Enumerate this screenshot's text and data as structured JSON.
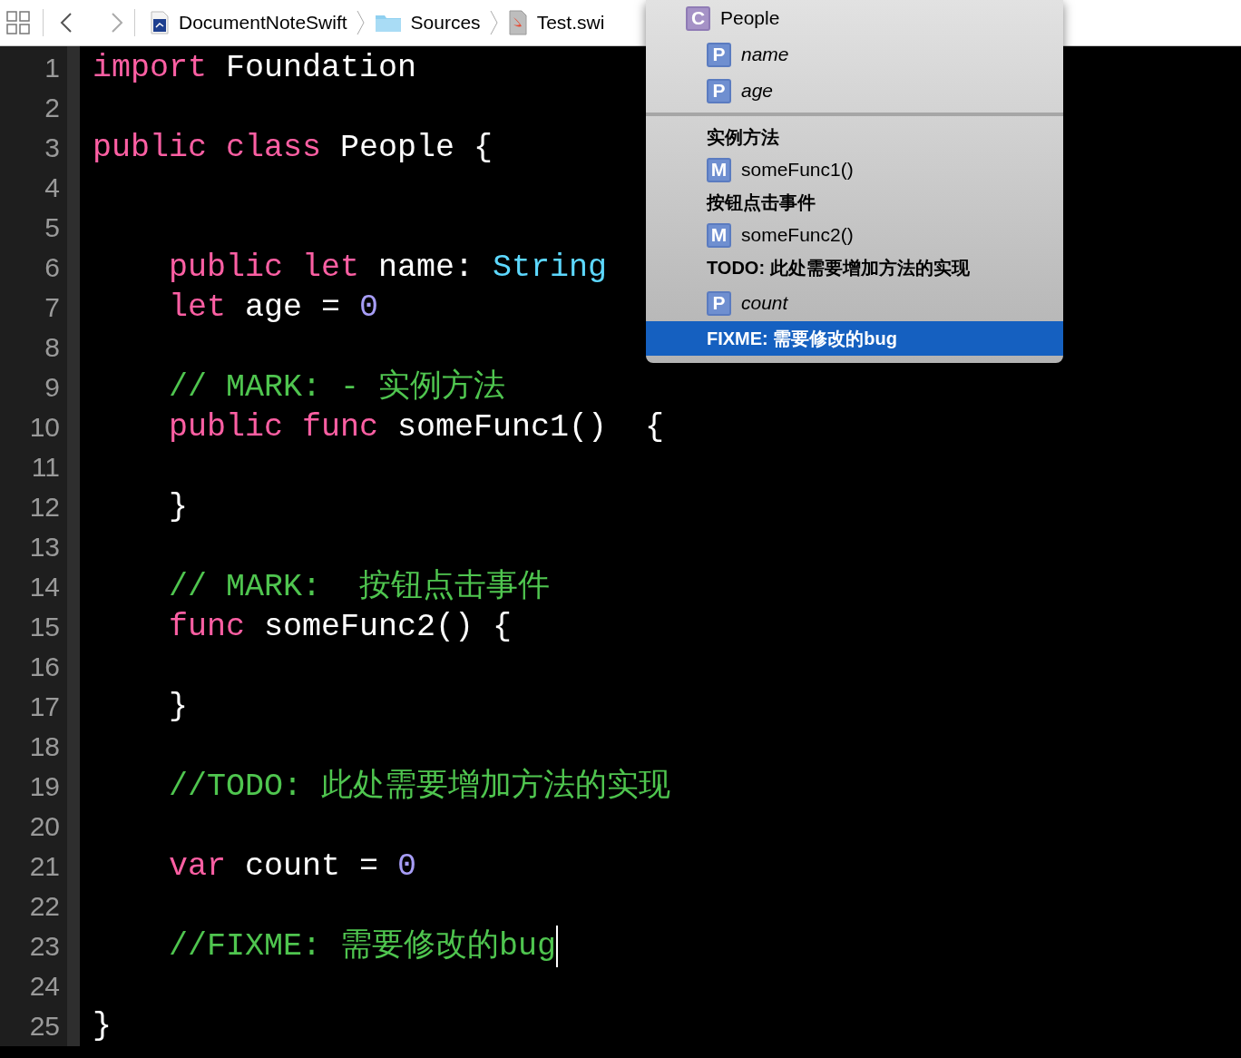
{
  "toolbar": {
    "breadcrumbs": [
      {
        "kind": "project",
        "label": "DocumentNoteSwift"
      },
      {
        "kind": "folder",
        "label": "Sources"
      },
      {
        "kind": "file",
        "label": "Test.swi"
      }
    ]
  },
  "editor": {
    "lines": [
      {
        "number": "1",
        "tokens": [
          {
            "kind": "keyword",
            "text": "import"
          },
          {
            "kind": "plain",
            "text": " Foundation"
          }
        ]
      },
      {
        "number": "2"
      },
      {
        "number": "3",
        "tokens": [
          {
            "kind": "keyword",
            "text": "public class"
          },
          {
            "kind": "plain",
            "text": " People {"
          }
        ]
      },
      {
        "number": "4"
      },
      {
        "number": "5"
      },
      {
        "number": "6",
        "tokens": [
          {
            "kind": "keyword",
            "text": "    public let"
          },
          {
            "kind": "plain",
            "text": " name: "
          },
          {
            "kind": "type",
            "text": "String"
          }
        ]
      },
      {
        "number": "7",
        "tokens": [
          {
            "kind": "keyword",
            "text": "    let"
          },
          {
            "kind": "plain",
            "text": " age = "
          },
          {
            "kind": "number",
            "text": "0"
          }
        ]
      },
      {
        "number": "8"
      },
      {
        "number": "9",
        "tokens": [
          {
            "kind": "comment",
            "text": "    // MARK: - 实例方法"
          }
        ]
      },
      {
        "number": "10",
        "tokens": [
          {
            "kind": "keyword",
            "text": "    public func"
          },
          {
            "kind": "plain",
            "text": " someFunc1()  {"
          }
        ]
      },
      {
        "number": "11"
      },
      {
        "number": "12",
        "tokens": [
          {
            "kind": "plain",
            "text": "    }"
          }
        ]
      },
      {
        "number": "13"
      },
      {
        "number": "14",
        "tokens": [
          {
            "kind": "comment",
            "text": "    // MARK:  按钮点击事件"
          }
        ]
      },
      {
        "number": "15",
        "tokens": [
          {
            "kind": "keyword",
            "text": "    func"
          },
          {
            "kind": "plain",
            "text": " someFunc2() {"
          }
        ]
      },
      {
        "number": "16"
      },
      {
        "number": "17",
        "tokens": [
          {
            "kind": "plain",
            "text": "    }"
          }
        ]
      },
      {
        "number": "18"
      },
      {
        "number": "19",
        "tokens": [
          {
            "kind": "comment",
            "text": "    //TODO: 此处需要增加方法的实现"
          }
        ]
      },
      {
        "number": "20"
      },
      {
        "number": "21",
        "tokens": [
          {
            "kind": "keyword",
            "text": "    var"
          },
          {
            "kind": "plain",
            "text": " count = "
          },
          {
            "kind": "number",
            "text": "0"
          }
        ]
      },
      {
        "number": "22"
      },
      {
        "number": "23",
        "caret": true,
        "tokens": [
          {
            "kind": "comment",
            "text": "    //FIXME: 需要修改的bug"
          }
        ]
      },
      {
        "number": "24"
      },
      {
        "number": "25",
        "tokens": [
          {
            "kind": "plain",
            "text": "}"
          }
        ]
      }
    ]
  },
  "symbol_menu": {
    "items": [
      {
        "kind": "class",
        "badge": "C",
        "label": "People",
        "selected": false
      },
      {
        "kind": "property",
        "badge": "P",
        "label": "name",
        "selected": false
      },
      {
        "kind": "property",
        "badge": "P",
        "label": "age",
        "selected": false
      },
      {
        "kind": "divider"
      },
      {
        "kind": "mark",
        "label": "实例方法",
        "selected": false
      },
      {
        "kind": "method",
        "badge": "M",
        "label": "someFunc1()",
        "selected": false
      },
      {
        "kind": "mark",
        "label": "按钮点击事件",
        "selected": false
      },
      {
        "kind": "method",
        "badge": "M",
        "label": "someFunc2()",
        "selected": false
      },
      {
        "kind": "mark",
        "label": "TODO: 此处需要增加方法的实现",
        "selected": false
      },
      {
        "kind": "property",
        "badge": "P",
        "label": "count",
        "selected": false
      },
      {
        "kind": "mark",
        "label": "FIXME: 需要修改的bug",
        "selected": true
      }
    ]
  }
}
